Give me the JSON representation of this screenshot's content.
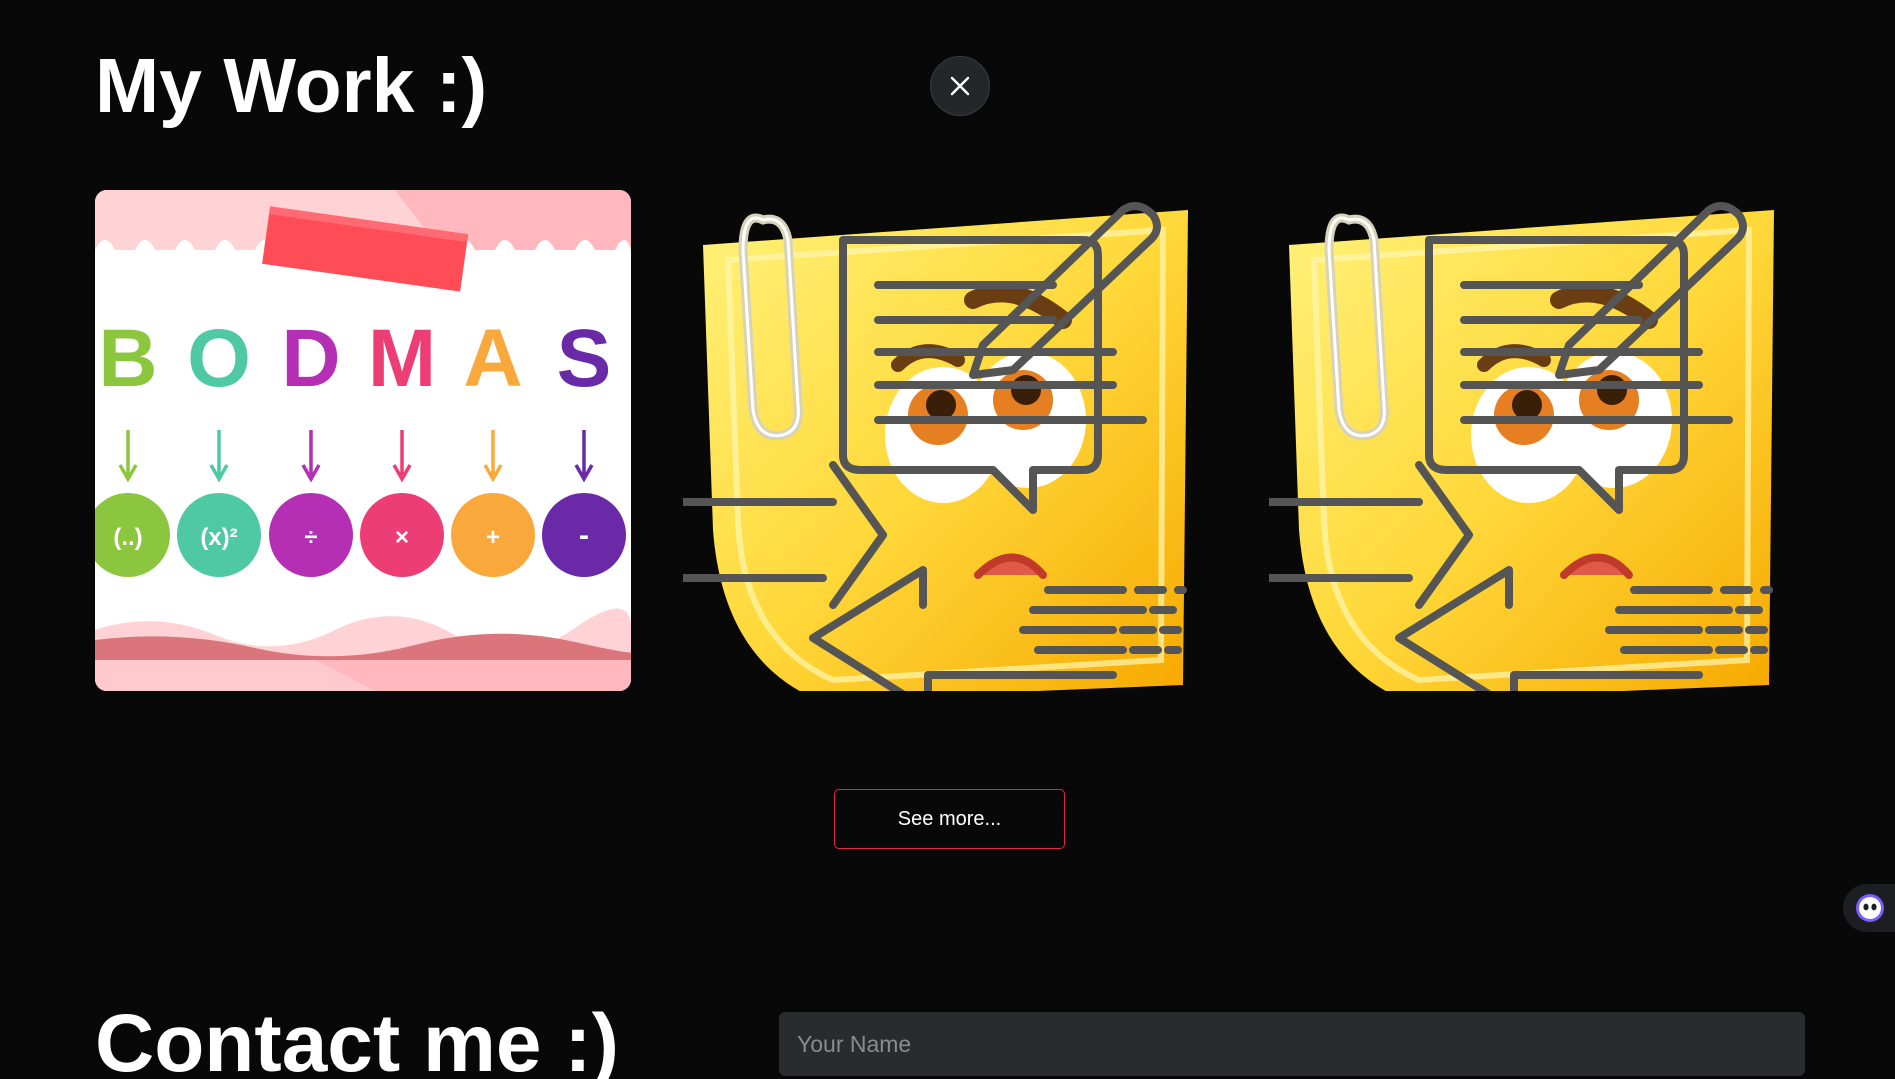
{
  "work_section": {
    "title": "My Work :)",
    "see_more_label": "See more...",
    "cards": [
      {
        "image": "bodmas-illustration",
        "letters": [
          "B",
          "O",
          "D",
          "M",
          "A",
          "S"
        ],
        "symbols": [
          "(..)",
          "(x)²",
          "÷",
          "×",
          "+",
          "-"
        ],
        "colors": [
          "#8cc63f",
          "#4fc9a4",
          "#b42fb4",
          "#ec3e74",
          "#f9a93c",
          "#6a2aa8"
        ]
      },
      {
        "image": "sticky-note-emoji-with-pencil-icon"
      },
      {
        "image": "sticky-note-emoji-with-pencil-icon"
      }
    ]
  },
  "contact_section": {
    "title": "Contact me :)",
    "name_placeholder": "Your Name"
  },
  "icons": {
    "close": "close-icon",
    "badge": "ghost-icon"
  },
  "colors": {
    "background": "#080808",
    "accent_border": "#e0254a",
    "input_bg": "#2a2b2e"
  }
}
